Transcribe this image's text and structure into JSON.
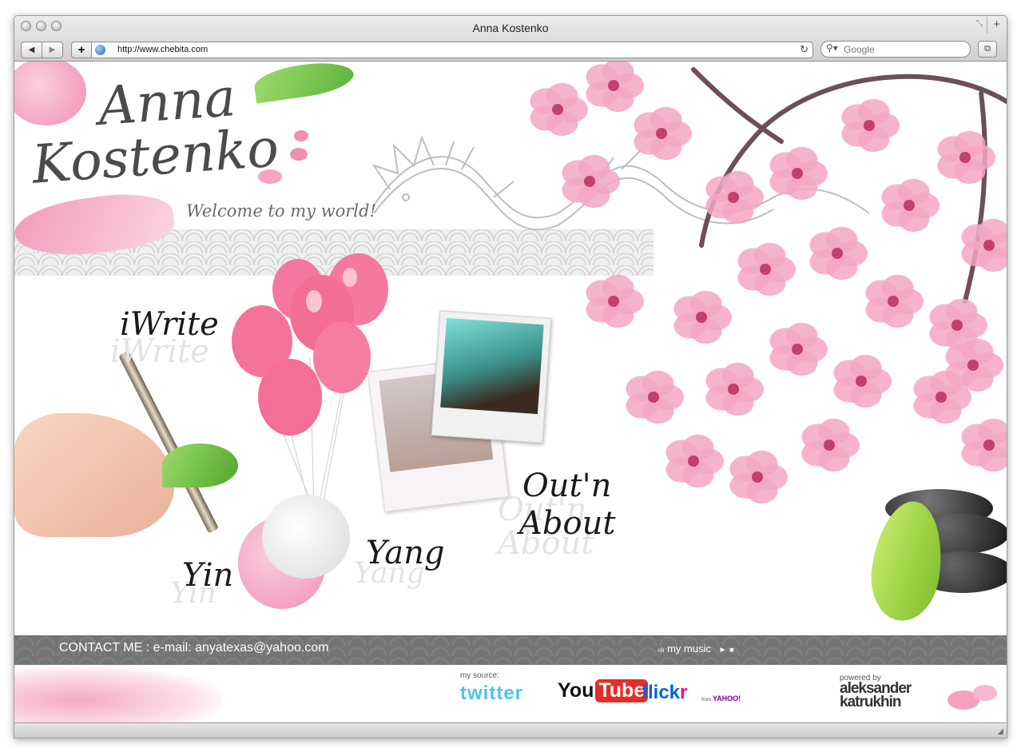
{
  "browser": {
    "window_title": "Anna Kostenko",
    "url": "http://www.chebita.com",
    "search_placeholder": "Google",
    "new_tab_label": "+",
    "add_label": "+"
  },
  "site": {
    "logo_line1": "Anna",
    "logo_line2": "Kostenko",
    "tagline": "Welcome to my world!",
    "nav": {
      "iwrite": "iWrite",
      "out_about_1": "Out'n",
      "out_about_2": "About",
      "yin": "Yin",
      "yang": "Yang"
    },
    "footer": {
      "contact": "CONTACT ME :   e-mail: anyatexas@yahoo.com",
      "my_music": "my music",
      "my_source": "my source:",
      "twitter": "twitter",
      "youtube_you": "You",
      "youtube_tube": "Tube",
      "flickr_flick": "flick",
      "flickr_r": "r",
      "flickr_from": "from",
      "yahoo": "YAHOO!",
      "powered_by": "powered by",
      "author_line1": "aleksander",
      "author_line2": "katrukhin"
    }
  },
  "colors": {
    "blossom": "#f2a7c3",
    "balloon": "#f26d96",
    "bar": "#747474",
    "twitter": "#4ec3ea",
    "youtube_red": "#e52d27",
    "flickr_blue": "#0063dc",
    "flickr_pink": "#ff0084"
  },
  "icons": [
    "back-icon",
    "forward-icon",
    "add-bookmark-icon",
    "globe-icon",
    "reload-icon",
    "search-icon",
    "bookmarks-icon",
    "music-play-icon",
    "music-stop-icon"
  ]
}
